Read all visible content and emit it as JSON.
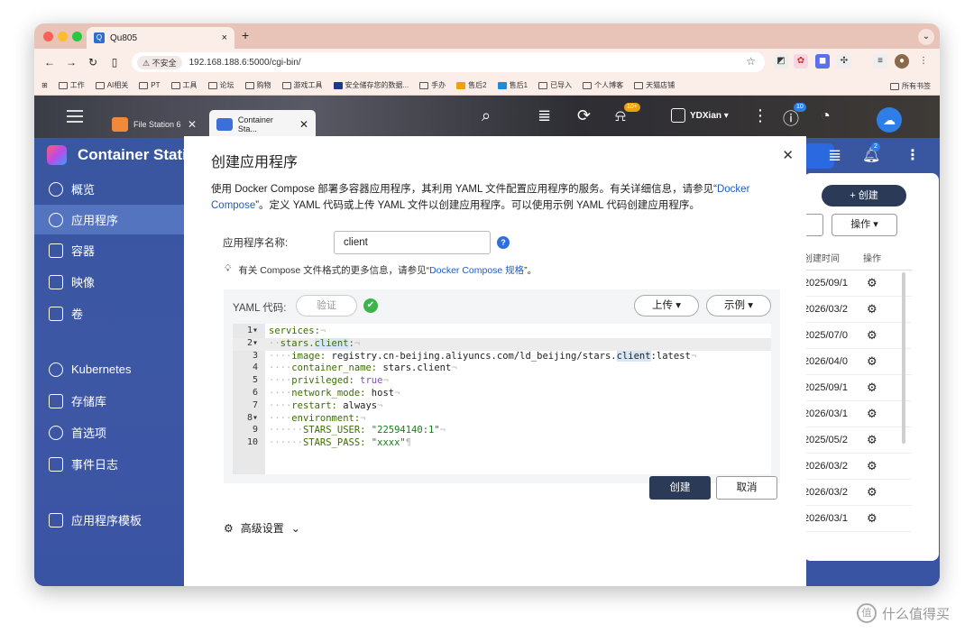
{
  "browser": {
    "tab_title": "Qu805",
    "tab_close": "×",
    "new_tab": "+",
    "security_label": "⚠ 不安全",
    "url": "192.168.188.6:5000/cgi-bin/",
    "bookmarks": [
      "工作",
      "AI相关",
      "PT",
      "工具",
      "论坛",
      "购物",
      "游戏工具",
      "安全储存您的数据...",
      "手办",
      "售后2",
      "售后1",
      "已导入",
      "个人博客",
      "天猫店铺"
    ],
    "all_bookmarks": "所有书签"
  },
  "qts": {
    "tabs": [
      {
        "label": "File Station 6",
        "close": "✕"
      },
      {
        "label": "Container Sta...",
        "close": "✕"
      }
    ],
    "notif_badge": "10+",
    "info_badge": "10",
    "username": "YDXian ▾"
  },
  "app": {
    "title": "Container Stati",
    "nav": [
      {
        "label": "概览"
      },
      {
        "label": "应用程序"
      },
      {
        "label": "容器"
      },
      {
        "label": "映像"
      },
      {
        "label": "卷"
      },
      {
        "label": "Kubernetes"
      },
      {
        "label": "存储库"
      },
      {
        "label": "首选项"
      },
      {
        "label": "事件日志"
      },
      {
        "label": "应用程序模板"
      }
    ],
    "create_button": "+ 创建",
    "ops_button": "操作 ▾",
    "notif_count": "2",
    "table": {
      "headers": [
        "创建时间",
        "操作"
      ],
      "rows": [
        "2025/09/1",
        "2026/03/2",
        "2025/07/0",
        "2026/04/0",
        "2025/09/1",
        "2026/03/1",
        "2025/05/2",
        "2026/03/2",
        "2026/03/2",
        "2026/03/1"
      ]
    }
  },
  "modal": {
    "title": "创建应用程序",
    "desc_1": "使用 Docker Compose 部署多容器应用程序，其利用 YAML 文件配置应用程序的服务。有关详细信息，请参见“",
    "desc_link": "Docker Compose",
    "desc_2": "”。定义 YAML 代码或上传 YAML 文件以创建应用程序。可以使用示例 YAML 代码创建应用程序。",
    "name_label": "应用程序名称:",
    "name_value": "client",
    "tip_1": "有关 Compose 文件格式的更多信息，请参见“",
    "tip_link": "Docker Compose 规格",
    "tip_2": "”。",
    "yaml_label": "YAML 代码:",
    "verify_button": "验证",
    "upload_button": "上传 ▾",
    "example_button": "示例 ▾",
    "advanced": "高级设置",
    "create": "创建",
    "cancel": "取消",
    "code": {
      "l1": "services:",
      "l2_key": "stars.",
      "l2_hl": "client",
      "l3_key": "image:",
      "l3_val_a": " registry.cn-beijing.aliyuncs.com/ld_beijing/stars.",
      "l3_val_hl": "client",
      "l3_val_b": ":latest",
      "l4_key": "container_name:",
      "l4_val": " stars.client",
      "l5_key": "privileged:",
      "l5_val": " true",
      "l6_key": "network_mode:",
      "l6_val": " host",
      "l7_key": "restart:",
      "l7_val": " always",
      "l8_key": "environment:",
      "l9_key": "STARS_USER:",
      "l9_val": " \"22594140:1\"",
      "l10_key": "STARS_PASS:",
      "l10_val": " \"xxxx\""
    }
  },
  "watermark": "什么值得买"
}
